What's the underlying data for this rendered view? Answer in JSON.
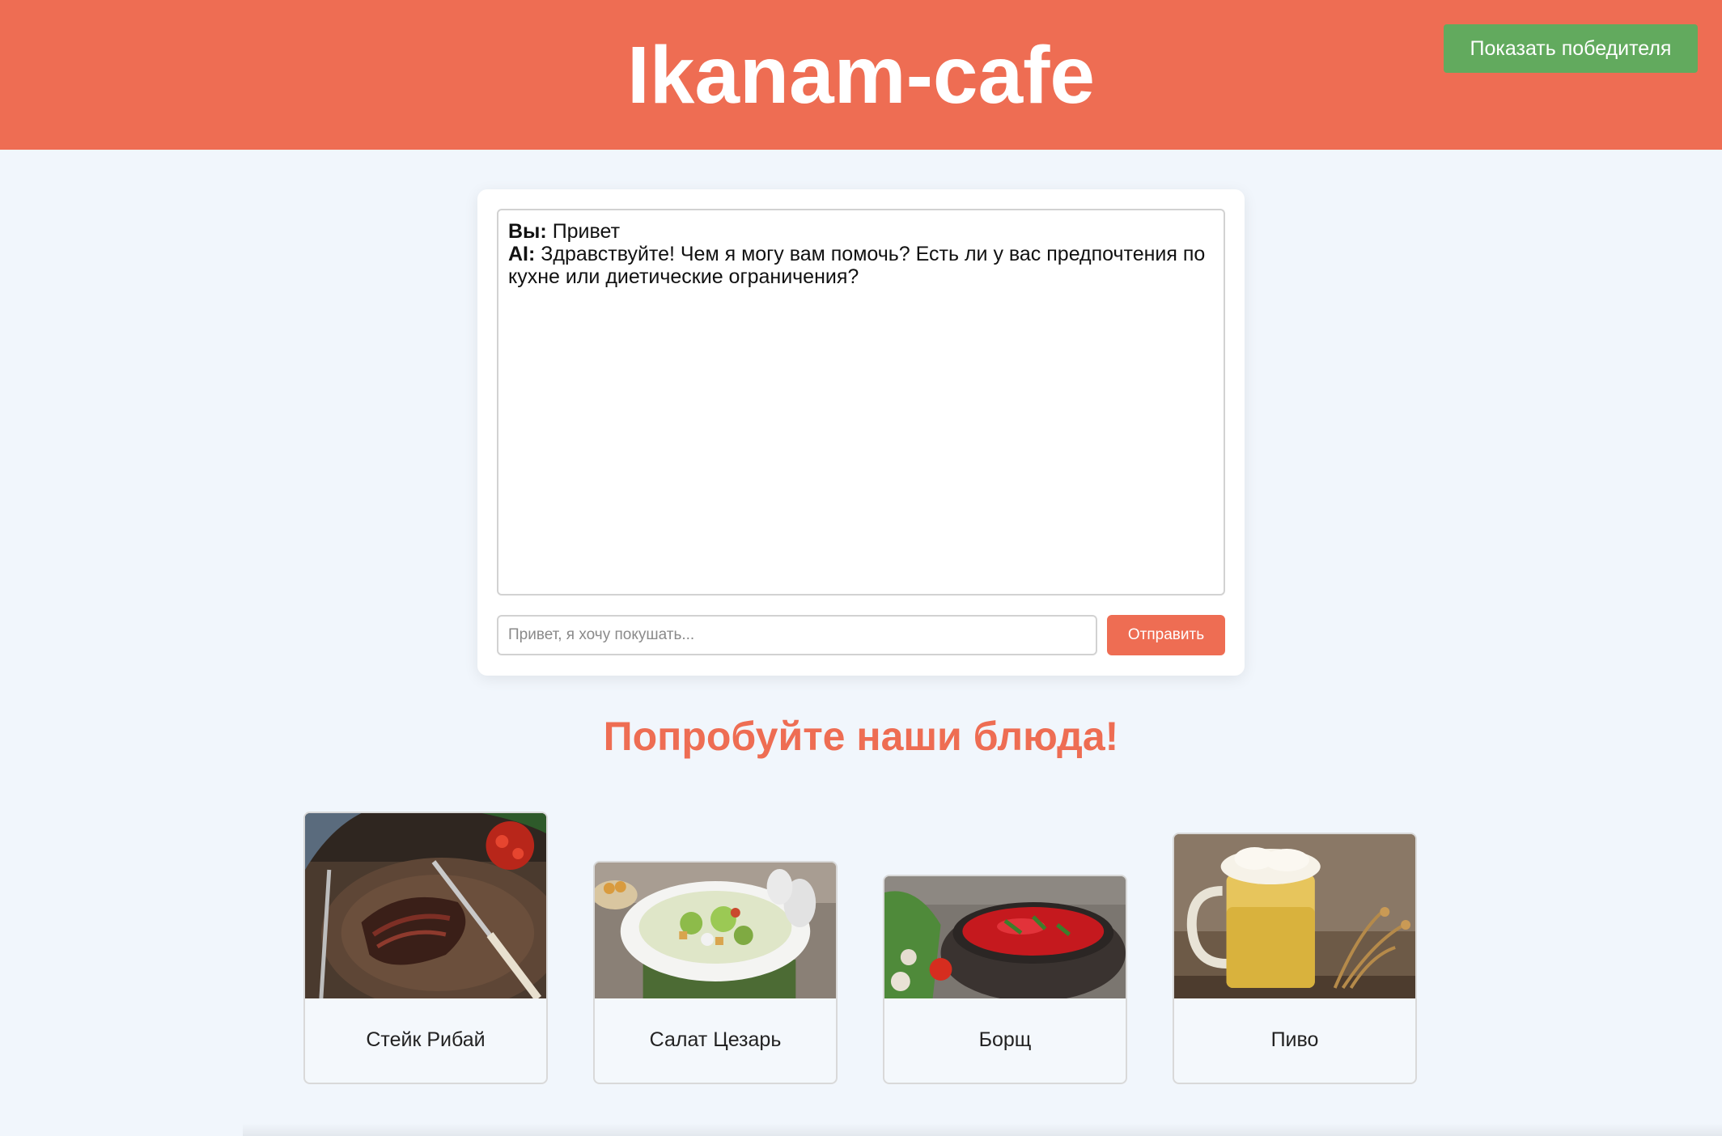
{
  "header": {
    "title": "Ikanam-cafe",
    "winner_button": "Показать победителя",
    "bg_color": "#ee6d53",
    "button_color": "#62aa5e"
  },
  "chat": {
    "messages": [
      {
        "speaker": "Вы:",
        "text": "Привет"
      },
      {
        "speaker": "AI:",
        "text": "Здравствуйте! Чем я могу вам помочь? Есть ли у вас предпочтения по кухне или диетические ограничения?"
      }
    ],
    "input": {
      "value": "",
      "placeholder": "Привет, я хочу покушать..."
    },
    "send_label": "Отправить"
  },
  "promo": {
    "title": "Попробуйте наши блюда!"
  },
  "dishes": [
    {
      "name": "Стейк Рибай",
      "image": "steak-photo"
    },
    {
      "name": "Салат Цезарь",
      "image": "caesar-salad-photo"
    },
    {
      "name": "Борщ",
      "image": "borscht-photo"
    },
    {
      "name": "Пиво",
      "image": "beer-photo"
    }
  ]
}
